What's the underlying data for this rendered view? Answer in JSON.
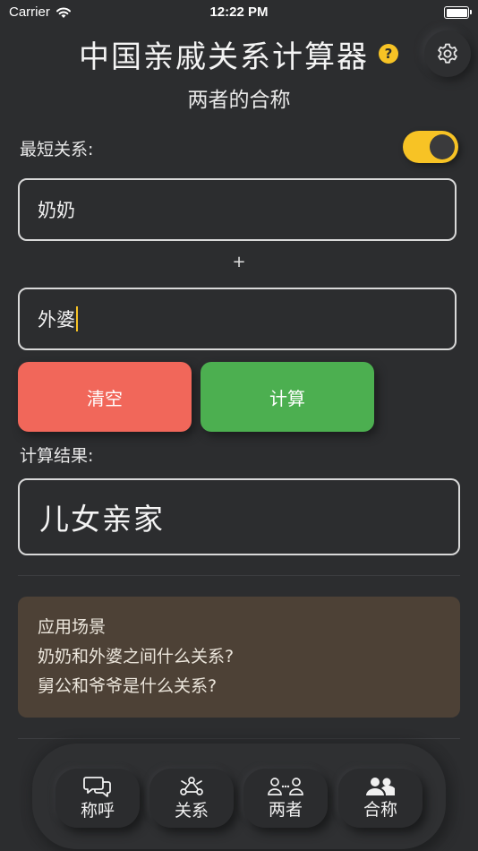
{
  "status": {
    "carrier": "Carrier",
    "time": "12:22 PM"
  },
  "header": {
    "title": "中国亲戚关系计算器",
    "help_icon_text": "?",
    "subtitle": "两者的合称"
  },
  "shortest": {
    "label": "最短关系:",
    "enabled": true
  },
  "inputs": {
    "first": {
      "value": "奶奶"
    },
    "plus": "+",
    "second": {
      "value": "外婆"
    }
  },
  "actions": {
    "clear_label": "清空",
    "calc_label": "计算"
  },
  "result": {
    "label": "计算结果:",
    "value": "儿女亲家"
  },
  "scenarios": {
    "title": "应用场景",
    "lines": [
      "奶奶和外婆之间什么关系?",
      "舅公和爷爷是什么关系?"
    ]
  },
  "tabs": [
    {
      "label": "称呼",
      "icon": "chat-bubbles-icon"
    },
    {
      "label": "关系",
      "icon": "relation-triangle-icon"
    },
    {
      "label": "两者",
      "icon": "two-persons-icon"
    },
    {
      "label": "合称",
      "icon": "group-icon"
    }
  ],
  "colors": {
    "accent": "#f7c325",
    "clear": "#f1675a",
    "calc": "#4caf50",
    "scenario_bg": "#4d4136"
  }
}
